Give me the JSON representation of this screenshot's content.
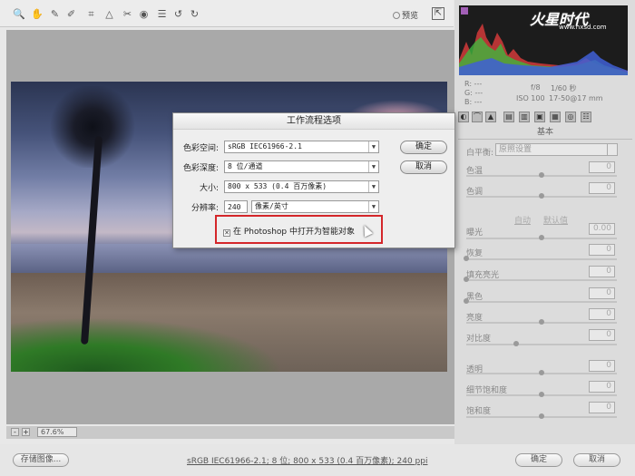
{
  "toolbar": {
    "tools": [
      {
        "name": "zoom-tool-icon",
        "glyph": "🔍"
      },
      {
        "name": "hand-tool-icon",
        "glyph": "✋"
      },
      {
        "name": "white-balance-tool-icon",
        "glyph": "✎"
      },
      {
        "name": "color-sampler-tool-icon",
        "glyph": "✐"
      },
      {
        "name": "crop-tool-icon",
        "glyph": "⌗"
      },
      {
        "name": "straighten-tool-icon",
        "glyph": "△"
      },
      {
        "name": "retouch-tool-icon",
        "glyph": "✂"
      },
      {
        "name": "red-eye-tool-icon",
        "glyph": "◉"
      },
      {
        "name": "list-icon",
        "glyph": "☰"
      },
      {
        "name": "rotate-left-icon",
        "glyph": "↺"
      },
      {
        "name": "rotate-right-icon",
        "glyph": "↻"
      }
    ],
    "preview_label": "预览"
  },
  "camera_readout": {
    "r": "R: ---",
    "g": "G: ---",
    "b": "B: ---",
    "aperture": "f/8",
    "shutter": "1/60 秒",
    "iso": "ISO 100",
    "lens": "17-50@17 mm"
  },
  "panel": {
    "section_title": "基本",
    "white_balance_label": "白平衡:",
    "white_balance_value": "原照设置",
    "auto_label": "自动",
    "default_label": "默认值",
    "sliders": [
      {
        "label": "色温",
        "value": "0",
        "level": 0.5
      },
      {
        "label": "色调",
        "value": "0",
        "level": 0.5
      },
      {
        "label": "曝光",
        "value": "0.00",
        "level": 0.5
      },
      {
        "label": "恢复",
        "value": "0",
        "level": 0.0
      },
      {
        "label": "填充亮光",
        "value": "0",
        "level": 0.0
      },
      {
        "label": "黑色",
        "value": "0",
        "level": 0.0
      },
      {
        "label": "亮度",
        "value": "0",
        "level": 0.5
      },
      {
        "label": "对比度",
        "value": "0",
        "level": 0.33
      },
      {
        "label": "透明",
        "value": "0",
        "level": 0.5
      },
      {
        "label": "细节饱和度",
        "value": "0",
        "level": 0.5
      },
      {
        "label": "饱和度",
        "value": "0",
        "level": 0.5
      }
    ]
  },
  "dialog": {
    "title": "工作流程选项",
    "color_space_label": "色彩空间:",
    "color_space_value": "sRGB IEC61966-2.1",
    "depth_label": "色彩深度:",
    "depth_value": "8 位/通道",
    "size_label": "大小:",
    "size_value": "800 x 533  (0.4 百万像素)",
    "resolution_label": "分辨率:",
    "resolution_value": "240",
    "resolution_unit": "像素/英寸",
    "ok_button": "确定",
    "cancel_button": "取消",
    "smart_object_label": "在 Photoshop 中打开为智能对象",
    "smart_object_checked": true
  },
  "status": {
    "zoom": "67.6%",
    "minus": "-",
    "plus": "+"
  },
  "footer": {
    "save_button": "存储图像...",
    "workflow_link": "sRGB IEC61966-2.1; 8 位; 800 x 533 (0.4 百万像素); 240 ppi",
    "ok_button": "确定",
    "cancel_button": "取消"
  },
  "watermark": {
    "logo_text": "火星时代",
    "url": "www.hxsd.com"
  }
}
